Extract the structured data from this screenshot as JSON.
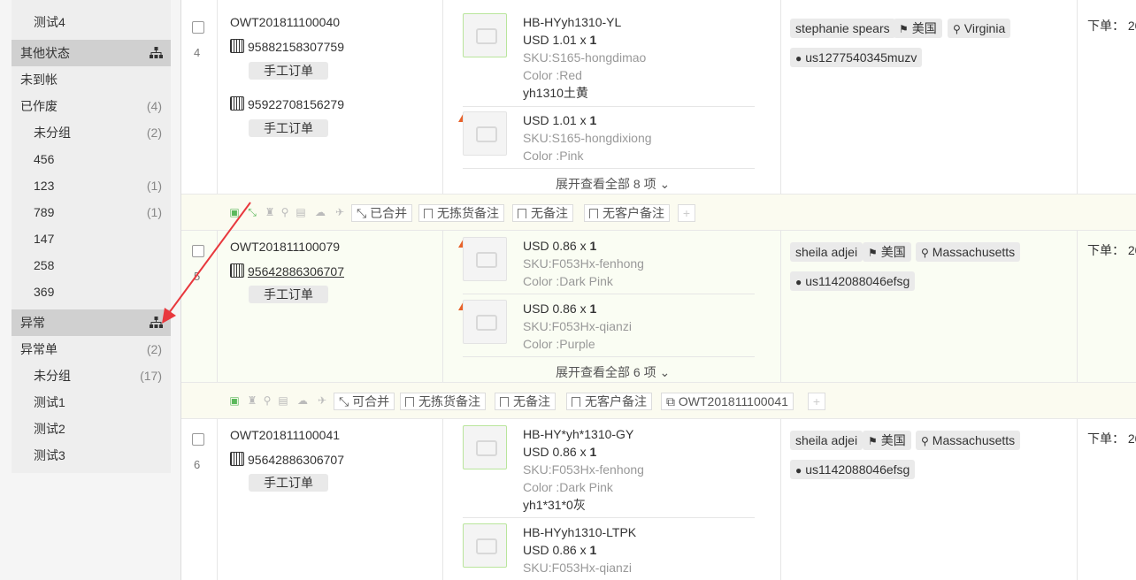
{
  "sidebar": {
    "top_items": [
      {
        "label": "测试4",
        "count": ""
      }
    ],
    "sections": [
      {
        "title": "其他状态",
        "items": [
          {
            "label": "未到帐",
            "count": "",
            "sub": false
          },
          {
            "label": "已作废",
            "count": "(4)",
            "sub": false
          },
          {
            "label": "未分组",
            "count": "(2)",
            "sub": true
          },
          {
            "label": "456",
            "count": "",
            "sub": true
          },
          {
            "label": "123",
            "count": "(1)",
            "sub": true
          },
          {
            "label": "789",
            "count": "(1)",
            "sub": true
          },
          {
            "label": "147",
            "count": "",
            "sub": true
          },
          {
            "label": "258",
            "count": "",
            "sub": true
          },
          {
            "label": "369",
            "count": "",
            "sub": true
          }
        ]
      },
      {
        "title": "异常",
        "items": [
          {
            "label": "异常单",
            "count": "(2)",
            "sub": false
          },
          {
            "label": "未分组",
            "count": "(17)",
            "sub": true
          },
          {
            "label": "测试1",
            "count": "",
            "sub": true
          },
          {
            "label": "测试2",
            "count": "",
            "sub": true
          },
          {
            "label": "测试3",
            "count": "",
            "sub": true
          }
        ]
      }
    ]
  },
  "orders": [
    {
      "index": "4",
      "order_no": "OWT201811100040",
      "tracking": [
        {
          "number": "95882158307759",
          "button": "手工订单"
        },
        {
          "number": "95922708156279",
          "button": "手工订单"
        }
      ],
      "products": [
        {
          "sku_title": "HB-HYyh1310-YL",
          "price": "USD 1.01 x ",
          "qty": "1",
          "sku": "SKU:S165-hongdimao",
          "color": "Color :Red",
          "note": "yh1310土黄",
          "warning": false
        },
        {
          "sku_title": "",
          "price": "USD 1.01 x ",
          "qty": "1",
          "sku": "SKU:S165-hongdixiong",
          "color": "Color :Pink",
          "note": "",
          "warning": true
        }
      ],
      "expand": "展开查看全部 8 项 ⌄",
      "buyer": "stephanie spears",
      "country": "美国",
      "state": "Virginia",
      "account": "us1277540345muzv",
      "date": "下单：  20"
    },
    {
      "index": "5",
      "order_no": "OWT201811100079",
      "tracking": [
        {
          "number": "95642886306707",
          "button": "手工订单"
        }
      ],
      "products": [
        {
          "sku_title": "",
          "price": "USD 0.86 x ",
          "qty": "1",
          "sku": "SKU:F053Hx-fenhong",
          "color": "Color :Dark Pink",
          "note": "",
          "warning": true
        },
        {
          "sku_title": "",
          "price": "USD 0.86 x ",
          "qty": "1",
          "sku": "SKU:F053Hx-qianzi",
          "color": "Color :Purple",
          "note": "",
          "warning": true
        }
      ],
      "expand": "展开查看全部 6 项 ⌄",
      "buyer": "sheila adjei",
      "country": "美国",
      "state": "Massachusetts",
      "account": "us1142088046efsg",
      "date": "下单：  20"
    },
    {
      "index": "6",
      "order_no": "OWT201811100041",
      "tracking": [
        {
          "number": "95642886306707",
          "button": "手工订单"
        }
      ],
      "products": [
        {
          "sku_title": "HB-HY*yh*1310-GY",
          "price": "USD 0.86 x ",
          "qty": "1",
          "sku": "SKU:F053Hx-fenhong",
          "color": "Color :Dark Pink",
          "note": "yh1*31*0灰",
          "warning": false
        },
        {
          "sku_title": "HB-HYyh1310-LTPK",
          "price": "USD 0.86 x ",
          "qty": "1",
          "sku": "SKU:F053Hx-qianzi",
          "color": "",
          "note": "",
          "warning": false
        }
      ],
      "buyer": "sheila adjei",
      "country": "美国",
      "state": "Massachusetts",
      "account": "us1142088046efsg",
      "date": "下单：  20"
    }
  ],
  "action_bars": [
    {
      "merge": "已合并",
      "no_pick_note": "无拣货备注",
      "no_note": "无备注",
      "no_customer_note": "无客户备注",
      "linked_order": ""
    },
    {
      "merge": "可合并",
      "no_pick_note": "无拣货备注",
      "no_note": "无备注",
      "no_customer_note": "无客户备注",
      "linked_order": "OWT201811100041"
    }
  ],
  "icons": {
    "tracking": "barcode-icon",
    "flag": "flag-icon",
    "location": "map-marker-icon",
    "user": "user-icon",
    "warning": "warning-icon",
    "section": "sitemap-icon",
    "annotation_arrow_color": "#e8383d",
    "section_header_bg": "#d0d0d0"
  }
}
